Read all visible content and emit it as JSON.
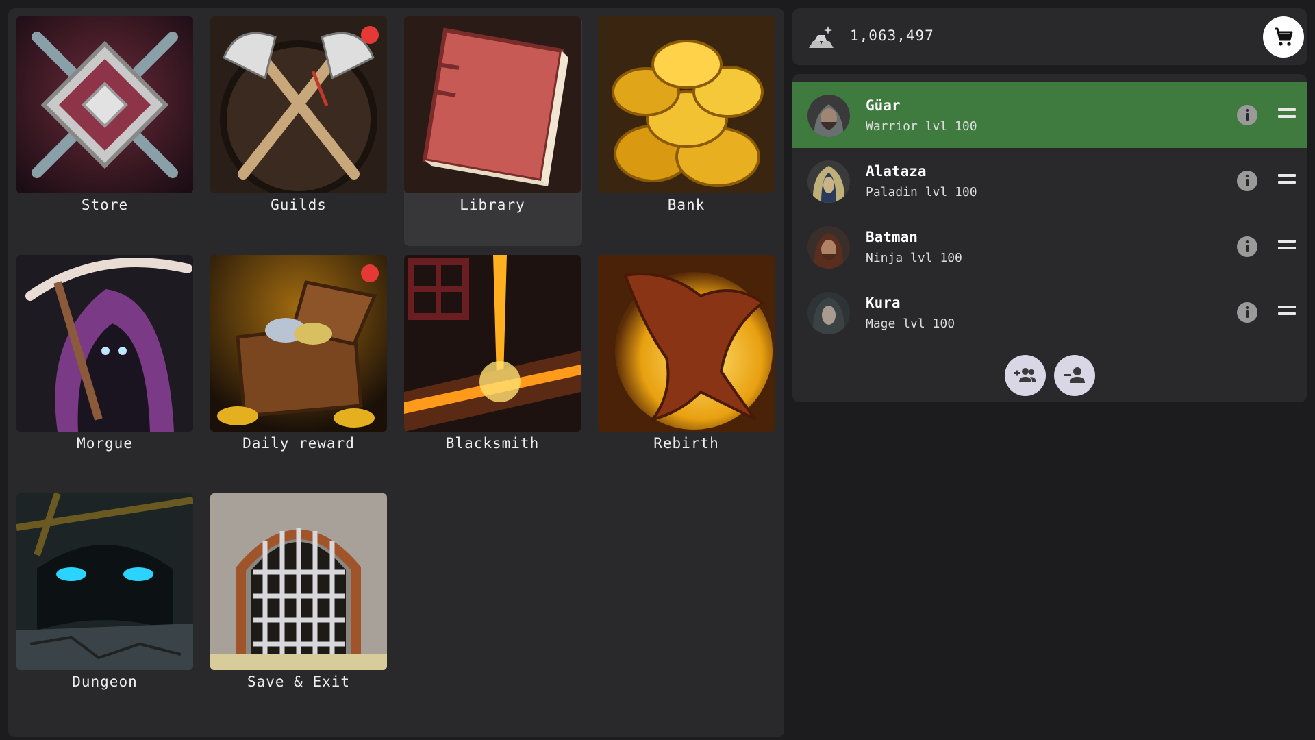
{
  "menu": {
    "tiles": [
      {
        "label": "Store",
        "notification": false
      },
      {
        "label": "Guilds",
        "notification": true
      },
      {
        "label": "Library",
        "notification": false,
        "selected": true
      },
      {
        "label": "Bank",
        "notification": false
      },
      {
        "label": "Morgue",
        "notification": false
      },
      {
        "label": "Daily reward",
        "notification": true
      },
      {
        "label": "Blacksmith",
        "notification": false
      },
      {
        "label": "Rebirth",
        "notification": false
      },
      {
        "label": "Dungeon",
        "notification": false
      },
      {
        "label": "Save & Exit",
        "notification": false
      }
    ]
  },
  "currency": {
    "icon": "silver-bars-icon",
    "value": "1,063,497",
    "shop_icon": "shopping-cart-icon"
  },
  "party": {
    "members": [
      {
        "name": "Güar",
        "subtitle": "Warrior lvl 100",
        "active": true
      },
      {
        "name": "Alataza",
        "subtitle": "Paladin lvl 100",
        "active": false
      },
      {
        "name": "Batman",
        "subtitle": "Ninja lvl 100",
        "active": false
      },
      {
        "name": "Kura",
        "subtitle": "Mage lvl 100",
        "active": false
      }
    ],
    "actions": [
      "add-member-icon",
      "remove-member-icon"
    ]
  },
  "colors": {
    "active_member": "#3f7a3f",
    "notification": "#e53935",
    "panel": "#29292b"
  }
}
